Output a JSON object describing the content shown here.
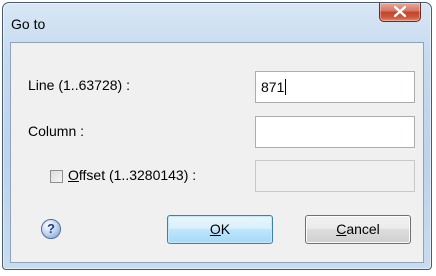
{
  "window": {
    "title": "Go to"
  },
  "fields": {
    "line_label_prefix": "Line (1..63728) :",
    "line_value": "871",
    "column_label": "Column :",
    "column_value": "",
    "offset_label_u": "O",
    "offset_label_rest": "ffset (1..3280143) :",
    "offset_checked": false,
    "offset_value": ""
  },
  "buttons": {
    "ok_u": "O",
    "ok_rest": "K",
    "cancel_u": "C",
    "cancel_rest": "ancel"
  },
  "icons": {
    "help": "?"
  }
}
